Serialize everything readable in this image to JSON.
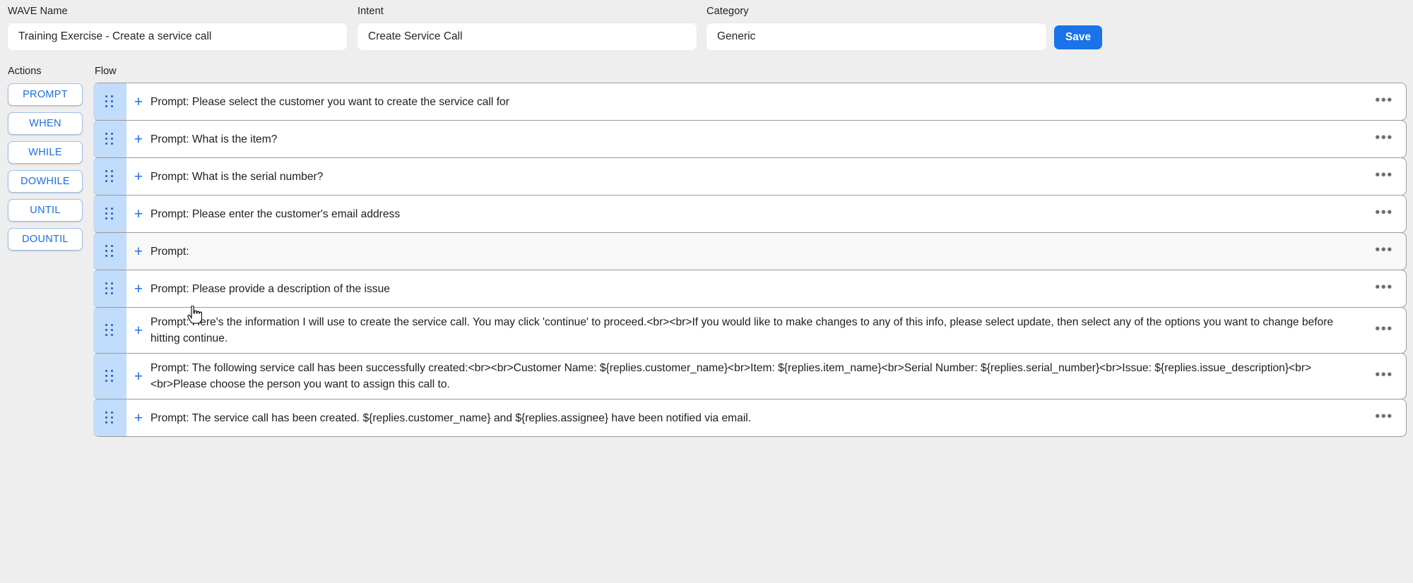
{
  "header": {
    "fields": [
      {
        "label": "WAVE Name",
        "value": "Training Exercise - Create a service call"
      },
      {
        "label": "Intent",
        "value": "Create Service Call"
      },
      {
        "label": "Category",
        "value": "Generic"
      }
    ],
    "save_label": "Save"
  },
  "actions": {
    "heading": "Actions",
    "items": [
      {
        "label": "PROMPT"
      },
      {
        "label": "WHEN"
      },
      {
        "label": "WHILE"
      },
      {
        "label": "DOWHILE"
      },
      {
        "label": "UNTIL"
      },
      {
        "label": "DOUNTIL"
      }
    ]
  },
  "flow": {
    "heading": "Flow",
    "add_icon": "+",
    "drag_icon": "drag-handle-icon",
    "menu_icon": "•••",
    "rows": [
      {
        "text": "Prompt: Please select the customer you want to create the service call for",
        "hovered": false
      },
      {
        "text": "Prompt: What is the item?",
        "hovered": false
      },
      {
        "text": "Prompt: What is the serial number?",
        "hovered": false
      },
      {
        "text": "Prompt: Please enter the customer's email address",
        "hovered": false
      },
      {
        "text": "Prompt:",
        "hovered": true
      },
      {
        "text": "Prompt: Please provide a description of the issue",
        "hovered": false
      },
      {
        "text": "Prompt: Here's the information I will use to create the service call. You may click 'continue' to proceed.<br><br>If you would like to make changes to any of this info, please select update, then select any of the options you want to change before hitting continue.",
        "hovered": false
      },
      {
        "text": "Prompt: The following service call has been successfully created:<br><br>Customer Name: ${replies.customer_name}<br>Item: ${replies.item_name}<br>Serial Number: ${replies.serial_number}<br>Issue: ${replies.issue_description}<br><br>Please choose the person you want to assign this call to.",
        "hovered": false
      },
      {
        "text": "Prompt: The service call has been created. ${replies.customer_name} and ${replies.assignee} have been notified via email.",
        "hovered": false
      }
    ]
  },
  "colors": {
    "accent": "#1a73e8",
    "handle_bg": "#c2dcfb",
    "page_bg": "#eeeeee",
    "action_border": "#9fc0ea"
  }
}
